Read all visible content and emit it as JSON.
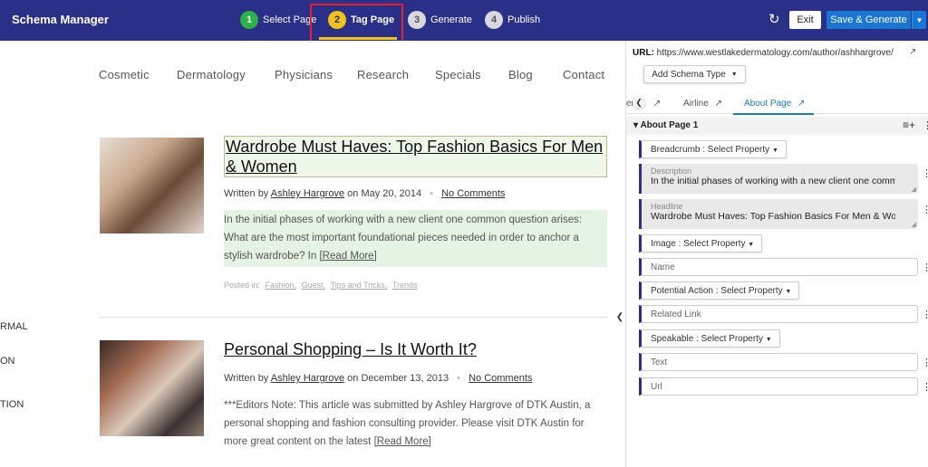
{
  "header": {
    "app_title": "Schema Manager",
    "steps": [
      {
        "num": "1",
        "label": "Select Page"
      },
      {
        "num": "2",
        "label": "Tag Page"
      },
      {
        "num": "3",
        "label": "Generate"
      },
      {
        "num": "4",
        "label": "Publish"
      }
    ],
    "refresh_icon": "↻",
    "exit_label": "Exit",
    "save_label": "Save & Generate",
    "dropdown_icon": "▼"
  },
  "site": {
    "nav": [
      "Cosmetic",
      "Dermatology",
      "Physicians",
      "Research",
      "Specials",
      "Blog",
      "Contact"
    ],
    "left_edge_text": [
      "RMAL",
      "ON",
      "TION"
    ],
    "posts": [
      {
        "title": "Wardrobe Must Haves: Top Fashion Basics For Men & Women",
        "written_by": "Written by",
        "author": "Ashley Hargrove",
        "on": "on",
        "date": "May 20, 2014",
        "separator": "•",
        "comments": "No Comments",
        "excerpt": "In the initial phases of working with a new client one common question arises: What are the most important foundational pieces needed in order to anchor a stylish wardrobe? In",
        "read_more": "[Read More]",
        "posted_in_label": "Posted in:",
        "categories": [
          "Fashion,",
          "Guest,",
          "Tips and Tricks,",
          "Trends"
        ]
      },
      {
        "title": "Personal Shopping – Is It Worth It?",
        "written_by": "Written by",
        "author": "Ashley Hargrove",
        "on": "on",
        "date": "December 13, 2013",
        "separator": "•",
        "comments": "No Comments",
        "excerpt": "***Editors Note: This article was submitted by Ashley Hargrove of DTK Austin, a personal shopping and fashion consulting provider. Please visit DTK Austin for more great content on the latest",
        "read_more": "[Read More]"
      }
    ]
  },
  "panel": {
    "url_label": "URL:",
    "url_value": "https://www.westlakedermatology.com/author/ashhargrove/",
    "add_schema_label": "Add Schema Type",
    "tabs": [
      {
        "label": "er"
      },
      {
        "label": "Airline"
      },
      {
        "label": "About Page"
      }
    ],
    "section_title": "About Page 1",
    "properties": {
      "breadcrumb": "Breadcrumb : Select Property",
      "description_label": "Description",
      "description_value": "In the initial phases of working with a new client one common question arises",
      "headline_label": "Headline",
      "headline_value": "Wardrobe Must Haves: Top Fashion Basics For Men & Women",
      "image": "Image : Select Property",
      "name_placeholder": "Name",
      "potential_action": "Potential Action : Select Property",
      "related_link_placeholder": "Related Link",
      "speakable": "Speakable : Select Property",
      "text_placeholder": "Text",
      "url_placeholder": "Url"
    }
  },
  "colors": {
    "header_bg": "#2a2f87",
    "step_done": "#2bb34a",
    "step_active": "#f2c21b",
    "highlight": "#e0202a",
    "primary": "#1976d2"
  }
}
